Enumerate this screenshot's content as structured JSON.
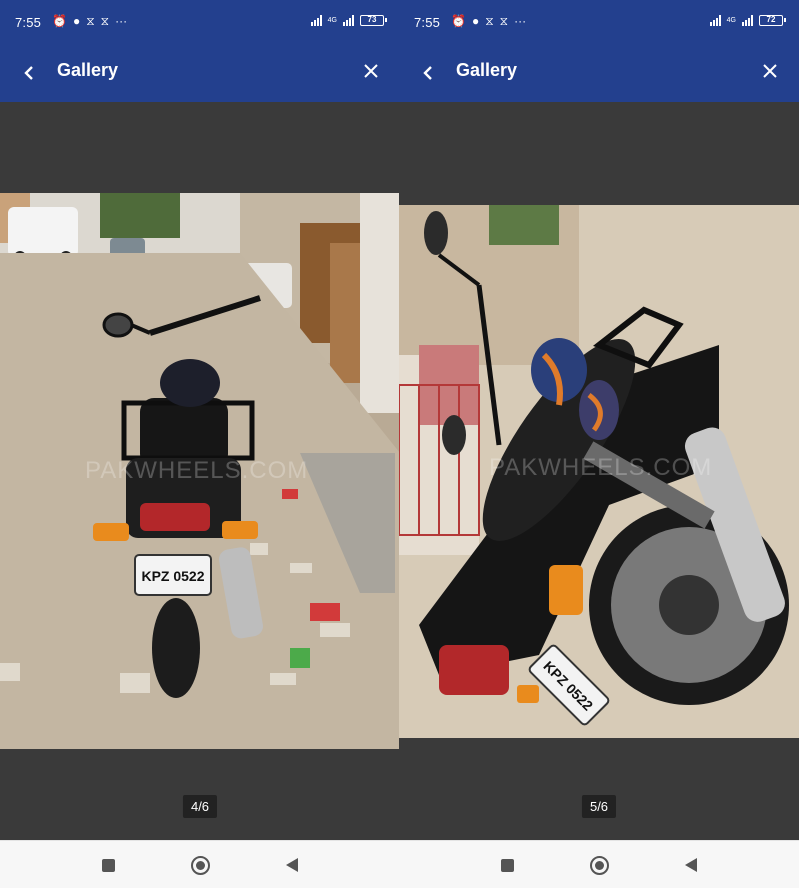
{
  "screens": [
    {
      "status": {
        "time": "7:55",
        "network": "4G",
        "battery": "73"
      },
      "header": {
        "title": "Gallery"
      },
      "photo": {
        "plate": "KPZ 0522",
        "watermark": "PAKWHEELS.COM"
      },
      "counter": "4/6"
    },
    {
      "status": {
        "time": "7:55",
        "network": "4G",
        "battery": "72"
      },
      "header": {
        "title": "Gallery"
      },
      "photo": {
        "plate": "KPZ 0522",
        "watermark": "PAKWHEELS.COM"
      },
      "counter": "5/6"
    }
  ],
  "colors": {
    "appbar": "#23408e",
    "viewer": "#3a3a3a",
    "navbar": "#f7f7f7"
  },
  "icons": [
    "alarm-icon",
    "chat-icon",
    "notification-icon",
    "more-icon",
    "signal-icon",
    "battery-icon",
    "back-arrow-icon",
    "close-icon",
    "recents-icon",
    "home-icon",
    "back-icon"
  ]
}
